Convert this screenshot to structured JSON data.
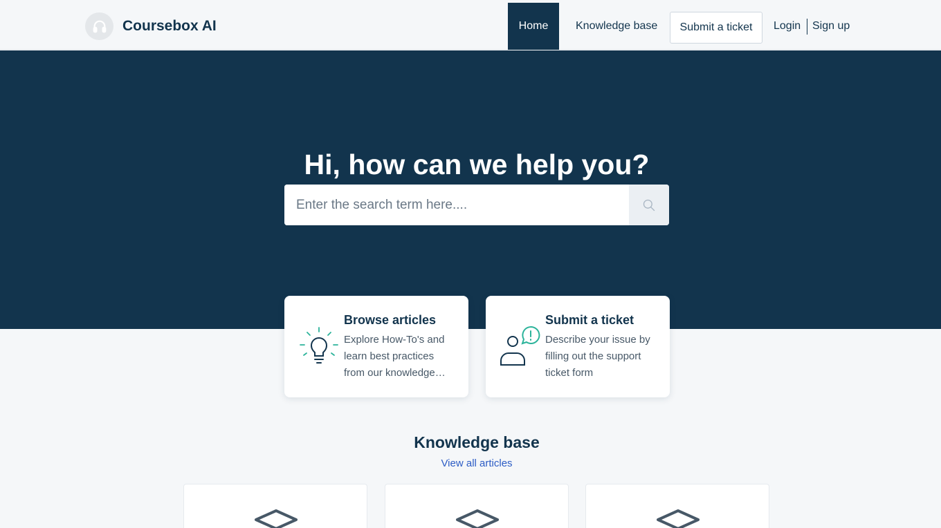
{
  "header": {
    "brand": "Coursebox AI",
    "logo_icon": "headphones-icon",
    "nav": {
      "home": "Home",
      "knowledge_base": "Knowledge base",
      "submit_ticket": "Submit a ticket",
      "login": "Login",
      "signup": "Sign up"
    }
  },
  "hero": {
    "title": "Hi, how can we help you?",
    "search": {
      "placeholder": "Enter the search term here....",
      "button_icon": "search-icon"
    }
  },
  "cards": [
    {
      "title": "Browse articles",
      "description": "Explore How-To's and learn best practices from our knowledge base",
      "icon": "lightbulb-icon"
    },
    {
      "title": "Submit a ticket",
      "description": "Describe your issue by filling out the support ticket form",
      "icon": "person-alert-icon"
    }
  ],
  "knowledge_base": {
    "title": "Knowledge base",
    "view_all": "View all articles",
    "folder_icon": "layers-icon"
  },
  "colors": {
    "primary": "#12344d",
    "accent": "#2bb39a",
    "link": "#2c5cc5",
    "background": "#f5f7f9"
  }
}
